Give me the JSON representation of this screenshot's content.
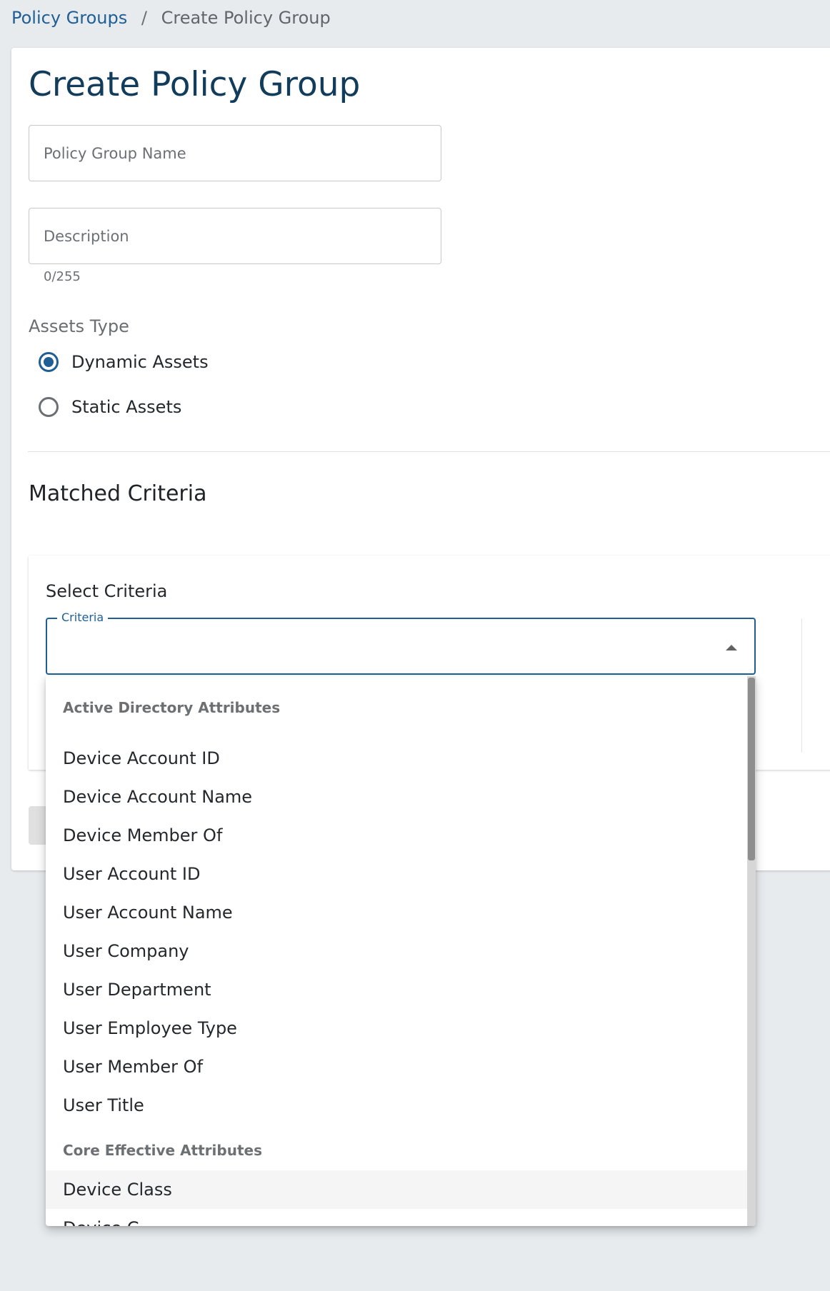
{
  "breadcrumb": {
    "parent": "Policy Groups",
    "separator": "/",
    "current": "Create Policy Group"
  },
  "page": {
    "title": "Create Policy Group"
  },
  "form": {
    "name_placeholder": "Policy Group Name",
    "name_value": "",
    "description_placeholder": "Description",
    "description_value": "",
    "description_counter": "0/255",
    "assets_type_label": "Assets Type",
    "assets_type_options": [
      {
        "label": "Dynamic Assets",
        "selected": true
      },
      {
        "label": "Static Assets",
        "selected": false
      }
    ]
  },
  "criteria_section": {
    "title": "Matched Criteria",
    "panel_label": "Select Criteria",
    "select_legend": "Criteria",
    "select_value": ""
  },
  "dropdown": {
    "groups": [
      {
        "header": "Active Directory Attributes",
        "items": [
          "Device Account ID",
          "Device Account Name",
          "Device Member Of",
          "User Account ID",
          "User Account Name",
          "User Company",
          "User Department",
          "User Employee Type",
          "User Member Of",
          "User Title"
        ]
      },
      {
        "header": "Core Effective Attributes",
        "items": [
          "Device Class",
          "Device C..."
        ]
      }
    ],
    "hovered_item": "Device Class"
  },
  "colors": {
    "primary": "#1f5f96",
    "title": "#123c5b",
    "page_background": "#e8ebee"
  }
}
